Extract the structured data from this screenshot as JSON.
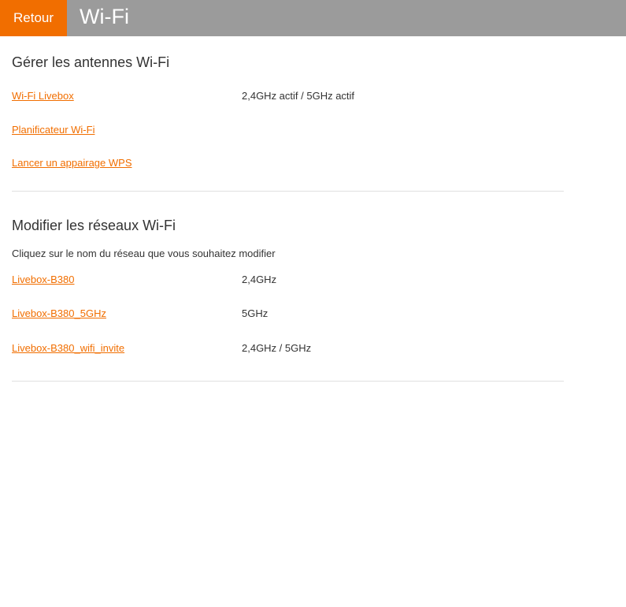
{
  "header": {
    "back_label": "Retour",
    "title": "Wi-Fi",
    "colors": {
      "accent": "#f16e00",
      "bar": "#9b9b9b"
    }
  },
  "antennas": {
    "title": "Gérer les antennes Wi-Fi",
    "items": [
      {
        "label": "Wi-Fi Livebox",
        "value": "2,4GHz actif / 5GHz actif"
      },
      {
        "label": "Planificateur Wi-Fi"
      },
      {
        "label": "Lancer un appairage WPS"
      }
    ]
  },
  "networks": {
    "title": "Modifier les réseaux Wi-Fi",
    "hint": "Cliquez sur le nom du réseau que vous souhaitez modifier",
    "items": [
      {
        "label": "Livebox-B380",
        "value": "2,4GHz"
      },
      {
        "label": "Livebox-B380_5GHz",
        "value": "5GHz"
      },
      {
        "label": "Livebox-B380_wifi_invite",
        "value": "2,4GHz / 5GHz"
      }
    ]
  }
}
